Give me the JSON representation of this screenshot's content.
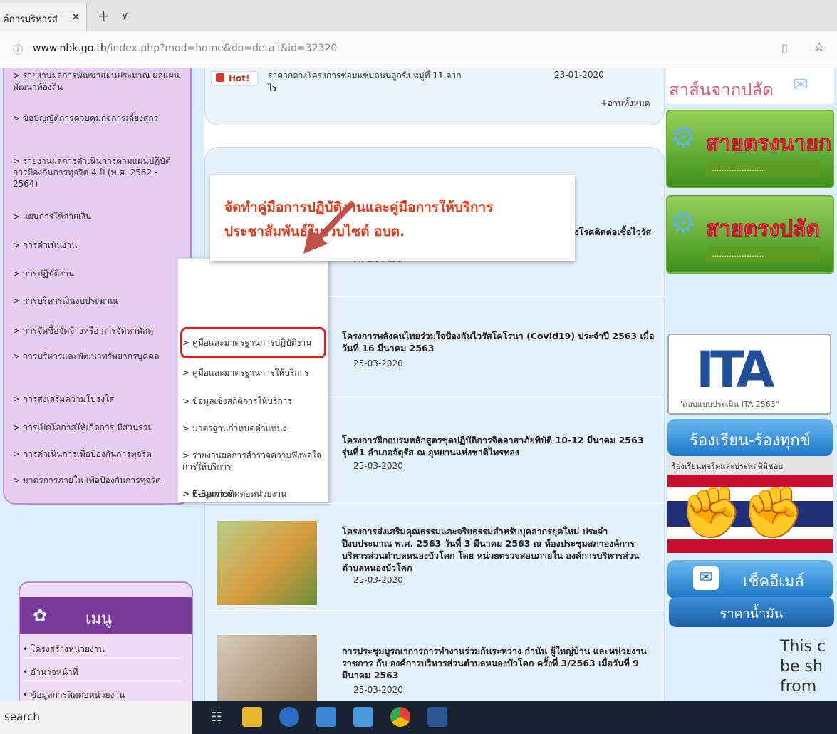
{
  "browser": {
    "tab_title": "ค์การบริหารส่",
    "tab_close": "✕",
    "new_tab": "+",
    "tab_menu": "∨",
    "url_host": "www.nbk.go.th",
    "url_path": "/index.php?mod=home&do=detail&id=32320",
    "info_icon": "ⓘ",
    "reader_icon": "▯",
    "star_icon": "☆"
  },
  "left_sidebar": {
    "items": [
      {
        "label": "> รายงานผลการพัฒนาแผนประมาณ ผลแผนพัฒนาท้องถิ่น"
      },
      {
        "label": "> ข้อปัญญัติการควบคุมกิจการเลี้ยงสุกร"
      },
      {
        "label": "> รายงานผลการดำเนินการตามแผนปฏิบัติการป้องกันการทุจริต 4 ปี (พ.ศ. 2562 - 2564)"
      },
      {
        "label": "> แผนการใช้จ่ายเงิน"
      },
      {
        "label": "> การดำเนินงาน"
      },
      {
        "label": "> การปฏิบัติงาน"
      },
      {
        "label": "> การบริหารเงินงบประมาณ"
      },
      {
        "label": "> การจัดซื้อจัดจ้างหรือ การจัดหาพัสดุ"
      },
      {
        "label": "> การบริหารและพัฒนาทรัพยากรบุคคล"
      },
      {
        "label": "> การส่งเสริมความโปร่งใส"
      },
      {
        "label": "> การเปิดโอกาสให้เกิดการ มีส่วนร่วม"
      },
      {
        "label": "> การดำเนินการเพื่อป้องกันการทุจริต"
      },
      {
        "label": "> มาตรการภายใน เพื่อป้องกันการทุจริต"
      }
    ]
  },
  "menu_box": {
    "title": "เมนู",
    "items": [
      {
        "label": "• โครงสร้างหน่วยงาน"
      },
      {
        "label": "• อำนาจหน้าที่"
      },
      {
        "label": "• ข้อมูลการติดต่อหน่วยงาน"
      }
    ]
  },
  "dropdown": {
    "items": [
      {
        "label": "> คู่มือและมาตรฐานการปฏิบัติงาน"
      },
      {
        "label": "> คู่มือและมาตรฐานการให้บริการ"
      },
      {
        "label": "> ข้อมูลเชิงสถิติการให้บริการ"
      },
      {
        "label": "> มาตรฐานกำหนดตำแหน่ง"
      },
      {
        "label": "> รายงานผลการสำรวจความพึงพอใจการให้บริการ"
      },
      {
        "label": "> ข้อมูลการติดต่อหน่วยงาน"
      },
      {
        "label": "> E-Service"
      }
    ]
  },
  "callout": {
    "line1": "จัดทำคู่มือการปฏิบัติงานและคู่มือการให้บริการ",
    "line2": "ประชาสัมพันธ์ในเว็บไซต์ อบต."
  },
  "hot_news": {
    "badge": "Hot!",
    "text": "ราคากลางโครงการซ่อมแซมถนนลูกรัง หมู่ที่ 11 จากไร",
    "date": "23-01-2020",
    "read_all": "+อ่านทั้งหมด"
  },
  "news": [
    {
      "title": "กิจกรรมทำความสะอาด \"เพื่อลดความเสี่ยงการแพร่ระบาดของโรคติดต่อเชื้อไวรัสโคโรนา 2019\" (covid 19)",
      "date": "25-03-2020"
    },
    {
      "title": "โครงการพลังคนไทยร่วมใจป้องกันไวรัสโคโรนา (Covid19) ประจำปี 2563 เมื่อวันที่ 16 มีนาคม 2563",
      "date": "25-03-2020"
    },
    {
      "title": "โครงการฝึกอบรมหลักสูตรชุดปฏิบัติการจิตอาสาภัยพิบัติ 10-12 มีนาคม 2563 รุ่นที่1 อำเภอจัตุรัส ณ อุทยานแห่งชาติไทรทอง",
      "date": "25-03-2020"
    },
    {
      "title": "โครงการส่งเสริมคุณธรรมและจริยธรรมสำหรับบุคลากรยุคใหม่ ประจำปีงบประมาณ พ.ศ. 2563 วันที่ 3 มีนาคม 2563 ณ ห้องประชุมสภาองค์การบริหารส่วนตำบลหนองบัวโคก โดย หน่วยตรวจสอบภายใน องค์การบริหารส่วนตำบลหนองบัวโคก",
      "date": "25-03-2020"
    },
    {
      "title": "การประชุมบูรณาการการทำงานร่วมกันระหว่าง กำนัน ผู้ใหญ่บ้าน และหน่วยงานราชการ กับ องค์การบริหารส่วนตำบลหนองบัวโคก ครั้งที่ 3/2563 เมื่อวันที่ 9 มีนาคม 2563",
      "date": "25-03-2020"
    }
  ],
  "right_col": {
    "top_banner": "สาส์นจากปลัด",
    "banner1": "สายตรงนายก",
    "banner2": "สายตรงปลัด",
    "ita": "ITA",
    "ita_sub": "\"ตอบแบบประเมิน ITA 2563\"",
    "complaint": "ร้องเรียน-ร้องทุกข์",
    "corrupt": "ร้องเรียนทุจริตและประพฤติมิชอบ",
    "mail": "เช็คอีเมล์",
    "oil": "ราคาน้ำมัน",
    "scrap1": "This c",
    "scrap2": "be sh",
    "scrap3": "from"
  },
  "taskbar": {
    "search": "search"
  }
}
